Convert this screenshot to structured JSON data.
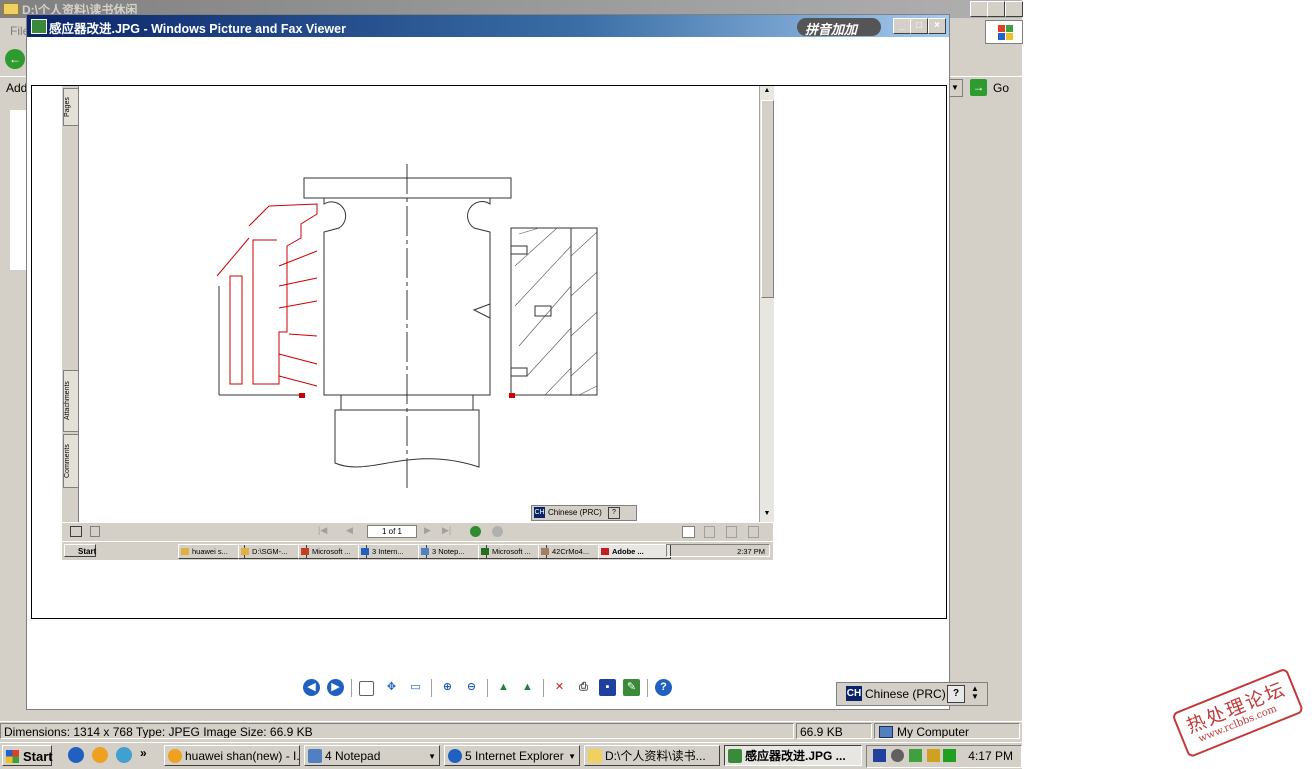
{
  "background_window": {
    "title": "D:\\个人资料\\读书休闲",
    "menu_label": "File",
    "address_label": "Add",
    "go_label": "Go"
  },
  "viewer": {
    "title": "感应器改进.JPG - Windows Picture and Fax Viewer",
    "pinyin_label": "拼音加加",
    "controls": {
      "minimize": "_",
      "maximize": "□",
      "close": "×"
    }
  },
  "inner_screenshot": {
    "tabs": [
      "Pages",
      "Attachments",
      "Comments"
    ],
    "page_indicator": "1 of 1",
    "language": {
      "code": "CH",
      "name": "Chinese (PRC)",
      "help": "?"
    },
    "taskbar": {
      "start": "Start",
      "items": [
        "huawei s...",
        "D:\\SGM-...",
        "Microsoft ...",
        "3 Intern...",
        "3 Notep...",
        "Microsoft ...",
        "42CrMo4...",
        "Adobe ..."
      ],
      "clock": "2:37 PM"
    }
  },
  "viewer_toolbar": {
    "icons": [
      "previous-image-icon",
      "next-image-icon",
      "best-fit-icon",
      "actual-size-icon",
      "slideshow-icon",
      "zoom-in-icon",
      "zoom-out-icon",
      "rotate-clockwise-icon",
      "rotate-counterclockwise-icon",
      "delete-icon",
      "print-icon",
      "save-icon",
      "edit-icon",
      "help-icon"
    ]
  },
  "language_bar": {
    "code": "CH",
    "name": "Chinese (PRC)",
    "help": "?"
  },
  "status_bar": {
    "details": "Dimensions: 1314 x 768 Type: JPEG Image Size: 66.9 KB",
    "size": "66.9 KB",
    "zone": "My Computer"
  },
  "taskbar": {
    "start": "Start",
    "items": [
      {
        "label": "huawei shan(new) - I...",
        "active": false
      },
      {
        "label": "4 Notepad",
        "active": false
      },
      {
        "label": "5 Internet Explorer",
        "active": false
      },
      {
        "label": "D:\\个人资料\\读书...",
        "active": false
      },
      {
        "label": "感应器改进.JPG ...",
        "active": true
      }
    ],
    "clock": "4:17 PM"
  },
  "watermark": {
    "name": "热处理论坛",
    "url": "www.rclbbs.com"
  },
  "colors": {
    "title_active_start": "#0a246a",
    "title_active_end": "#a6caf0",
    "chrome": "#d4d0c8",
    "annotation_red": "#cc0000",
    "watermark_red": "#c23a3a"
  }
}
